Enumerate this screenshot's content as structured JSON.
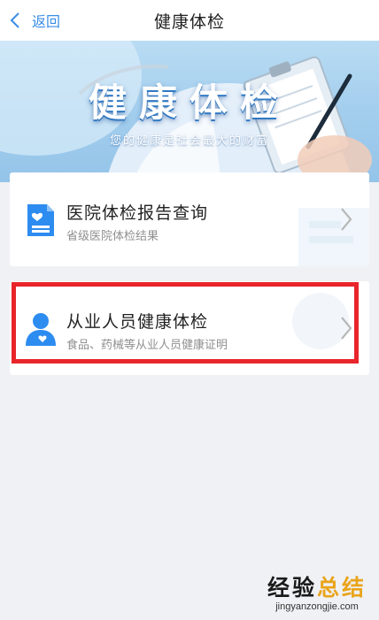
{
  "nav": {
    "back_label": "返回",
    "title": "健康体检"
  },
  "banner": {
    "title": "健康体检",
    "subtitle": "您的健康是社会最大的财富"
  },
  "cards": [
    {
      "title": "医院体检报告查询",
      "subtitle": "省级医院体检结果",
      "icon": "report-document-icon"
    },
    {
      "title": "从业人员健康体检",
      "subtitle": "食品、药械等从业人员健康证明",
      "icon": "worker-heart-icon"
    }
  ],
  "watermark": {
    "logo_part1": "经验",
    "logo_part2": "总结",
    "url": "jingyanzongjie.com"
  },
  "colors": {
    "accent": "#3a8ee6",
    "icon_blue": "#2d8cf0",
    "highlight": "#e8252b"
  }
}
